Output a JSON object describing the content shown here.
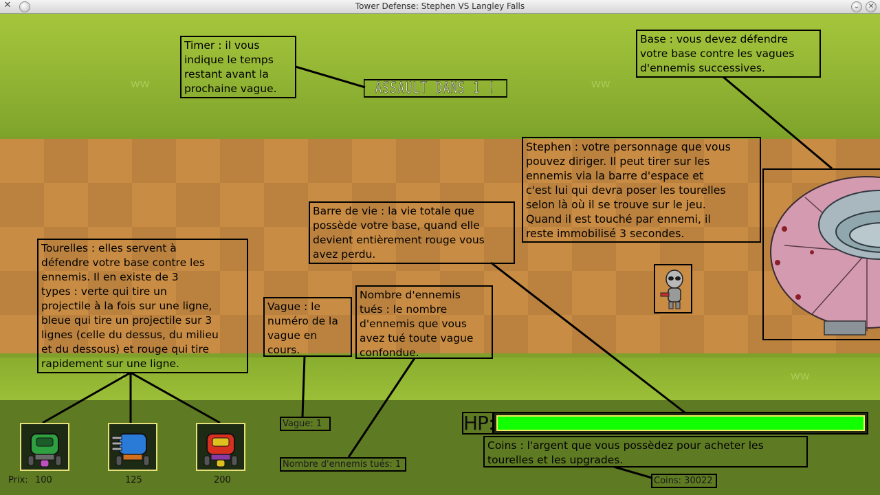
{
  "window": {
    "title": "Tower Defense: Stephen VS Langley Falls"
  },
  "assault_text": "ASSAULT DANS 1 !",
  "notes": {
    "timer": "Timer : il vous\nindique le temps\nrestant avant la\nprochaine vague.",
    "base": "Base : vous devez défendre\nvotre base contre les vagues\nd'ennemis successives.",
    "stephen": "Stephen : votre personnage que vous\npouvez diriger. Il peut tirer sur les\nennemis via la barre d'espace et\nc'est lui qui devra poser les tourelles\nselon là où il se trouve sur le jeu.\nQuand il est touché  par ennemi, il\nreste immobilisé 3 secondes.",
    "life": "Barre de vie : la vie totale que\npossède votre base, quand elle\ndevient entièrement rouge vous\navez perdu.",
    "turrets": "Tourelles : elles servent à\ndéfendre votre base contre les\nennemis. Il en existe de 3\ntypes : verte qui tire un\nprojectile à la fois sur une ligne,\nbleue qui tire un projectile sur 3\nlignes (celle du dessus, du milieu\net du dessous) et rouge qui tire\nrapidement sur une ligne.",
    "wave": "Vague : le\nnuméro de la\nvague en\ncours.",
    "kills": "Nombre d'ennemis\ntués : le nombre\nd'ennemis que vous\navez tué toute vague\nconfondue.",
    "coins": "Coins : l'argent que vous possèdez pour acheter les\ntourelles et les upgrades."
  },
  "hud": {
    "wave_label": "Vague:   1",
    "kills_label": "Nombre d'ennemis tués:  1",
    "hp_label": "HP:",
    "hp_fraction": 1.0,
    "coins_label": "Coins:  30022",
    "price_label": "Prix:",
    "prices": [
      "100",
      "125",
      "200"
    ]
  },
  "colors": {
    "hp_bar": "#11ff00",
    "turret_green": "#2ea040",
    "turret_blue": "#2a7ad8",
    "turret_red": "#d83020"
  },
  "icons": [
    "close-icon",
    "minimize-icon",
    "chevron-down-icon"
  ]
}
